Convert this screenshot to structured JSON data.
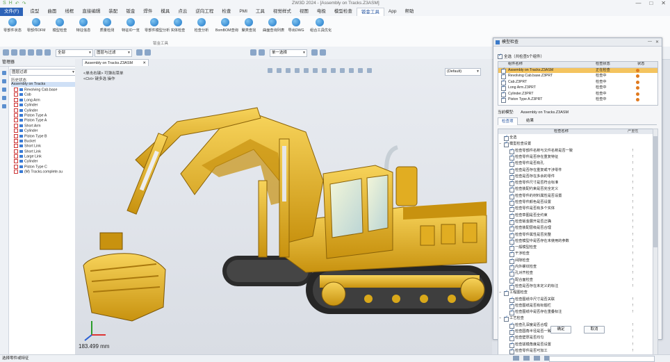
{
  "window": {
    "title": "ZW3D 2024 - [Assembly on Tracks.Z3ASM]",
    "quick_access": [
      "S",
      "H",
      "↶",
      "↷"
    ],
    "controls": [
      "—",
      "□",
      "✕"
    ]
  },
  "menu": {
    "tabs": [
      {
        "label": "文件(F)",
        "kind": "file"
      },
      {
        "label": "造型"
      },
      {
        "label": "曲面"
      },
      {
        "label": "线框"
      },
      {
        "label": "直接编辑"
      },
      {
        "label": "装配"
      },
      {
        "label": "钣金"
      },
      {
        "label": "焊件"
      },
      {
        "label": "模具"
      },
      {
        "label": "点云"
      },
      {
        "label": "逆向工程"
      },
      {
        "label": "检查"
      },
      {
        "label": "PMI"
      },
      {
        "label": "工具"
      },
      {
        "label": "视觉样式"
      },
      {
        "label": "视图"
      },
      {
        "label": "电极"
      },
      {
        "label": "模型检查"
      },
      {
        "label": "钣金工具",
        "active": true
      },
      {
        "label": "App"
      },
      {
        "label": "帮助"
      }
    ]
  },
  "ribbon": {
    "buttons": [
      "零部件状态",
      "零部件DFM",
      "模型检查",
      "特征信息",
      "质量检测",
      "特征ID一览",
      "零部件模型分析",
      "实体检查",
      "检查分析",
      "BomBOM查询",
      "聚类查找",
      "曲面查询列表",
      "导出DWG",
      "组合工具优化"
    ],
    "group_label": "钣金工具"
  },
  "toolbar": {
    "filter_value": "全部",
    "layer_value": "图层与过滤",
    "mode_value": "单一选择"
  },
  "tree": {
    "header": "管理器",
    "filter_placeholder": "图层过滤",
    "caption": "历史状态",
    "root": "Assembly on Tracks",
    "items": [
      "Revolving Cab.base",
      "Cab",
      "Long Arm",
      "Cylinder",
      "Cylinder",
      "Piston Type A",
      "Piston Type A",
      "Short Arm",
      "Cylinder",
      "Piston Type B",
      "Bucket",
      "Short Link",
      "Short Link",
      "Large Link",
      "Cylinder",
      "Piston Type C",
      "(M) Tracks.complete.su"
    ]
  },
  "viewport": {
    "doc_tab": "Assembly on Tracks.Z3ASM",
    "hint_line1": "<单击右键> 可弹出菜单",
    "hint_line2": "<Ctrl> 键多选 操作",
    "view_combo": "(Default)",
    "scale_readout": "183.499 mm"
  },
  "check_panel": {
    "title": "模型检查",
    "select_all_label": "全选（共检查5个组件）",
    "columns": [
      "组件名称",
      "检查状态",
      "状态"
    ],
    "rows": [
      {
        "name": "Assembly on Tracks.Z3ASM",
        "status": "正在检查",
        "selected": true
      },
      {
        "name": "Revolving Cab.base.Z3PRT",
        "status": "检查中"
      },
      {
        "name": "Cab.Z3PRT",
        "status": "检查中"
      },
      {
        "name": "Long Arm.Z3PRT",
        "status": "检查中"
      },
      {
        "name": "Cylinder.Z3PRT",
        "status": "检查中"
      },
      {
        "name": "Piston Type A.Z3PRT",
        "status": "检查中"
      }
    ],
    "current_model_label": "当前模型:",
    "current_model_value": "Assembly on Tracks.Z3ASM",
    "subtabs": [
      "检查项",
      "结果"
    ],
    "item_columns": [
      "检查名称",
      "严重性"
    ],
    "items": [
      {
        "indent": 0,
        "label": "全选"
      },
      {
        "indent": 0,
        "label": "模型检查设置",
        "group": true
      },
      {
        "indent": 1,
        "label": "检查零部件名称与文件名称是否一致"
      },
      {
        "indent": 1,
        "label": "检查零件是否存在重复特征"
      },
      {
        "indent": 1,
        "label": "检查零件是否有孔"
      },
      {
        "indent": 1,
        "label": "检查是否存在重复或干涉零件"
      },
      {
        "indent": 1,
        "label": "检查是否存在多余的零件"
      },
      {
        "indent": 1,
        "label": "检查零件尺寸是否符合标准"
      },
      {
        "indent": 1,
        "label": "检查装配约束是否完全定义"
      },
      {
        "indent": 1,
        "label": "检查零件的材料属性是否设置"
      },
      {
        "indent": 1,
        "label": "检查零件颜色是否设置"
      },
      {
        "indent": 1,
        "label": "检查零件是否有多个实体"
      },
      {
        "indent": 1,
        "label": "检查草图是否全约束"
      },
      {
        "indent": 1,
        "label": "检查钣金展开是否正确"
      },
      {
        "indent": 1,
        "label": "检查装配层级是否合理"
      },
      {
        "indent": 1,
        "label": "检查零件属性是否完整"
      },
      {
        "indent": 1,
        "label": "检查模型中是否存在未使用的参数"
      },
      {
        "indent": 1,
        "label": "一般模型检查"
      },
      {
        "indent": 1,
        "label": "干涉检查"
      },
      {
        "indent": 1,
        "label": "间隙检查"
      },
      {
        "indent": 1,
        "label": "内外螺纹检查"
      },
      {
        "indent": 1,
        "label": "孔对齐检查"
      },
      {
        "indent": 1,
        "label": "配合面检查"
      },
      {
        "indent": 1,
        "label": "检查是否存在未定义的标注"
      },
      {
        "indent": 0,
        "label": "工程图检查",
        "group": true
      },
      {
        "indent": 1,
        "label": "检查图纸中尺寸是否关联"
      },
      {
        "indent": 1,
        "label": "检查图纸是否有标题栏"
      },
      {
        "indent": 1,
        "label": "检查图纸中是否存在重叠标注"
      },
      {
        "indent": 0,
        "label": "工艺检查",
        "group": true
      },
      {
        "indent": 1,
        "label": "检查孔深度是否合理"
      },
      {
        "indent": 1,
        "label": "检查圆角半径是否一致"
      },
      {
        "indent": 1,
        "label": "检查壁厚是否均匀"
      },
      {
        "indent": 1,
        "label": "检查拔模角度是否设置"
      },
      {
        "indent": 1,
        "label": "检查零件是否可加工"
      }
    ],
    "severity_mark": "!",
    "ok_label": "确定",
    "cancel_label": "取消"
  },
  "status_bar": {
    "text": "选择零件或特征"
  },
  "colors": {
    "accent": "#2d63b8",
    "selection": "#f4c45f",
    "status_dot": "#e07a1f",
    "excavator_body": "#e6b422",
    "excavator_dark": "#a9780d",
    "tracks": "#2b2b2b"
  }
}
